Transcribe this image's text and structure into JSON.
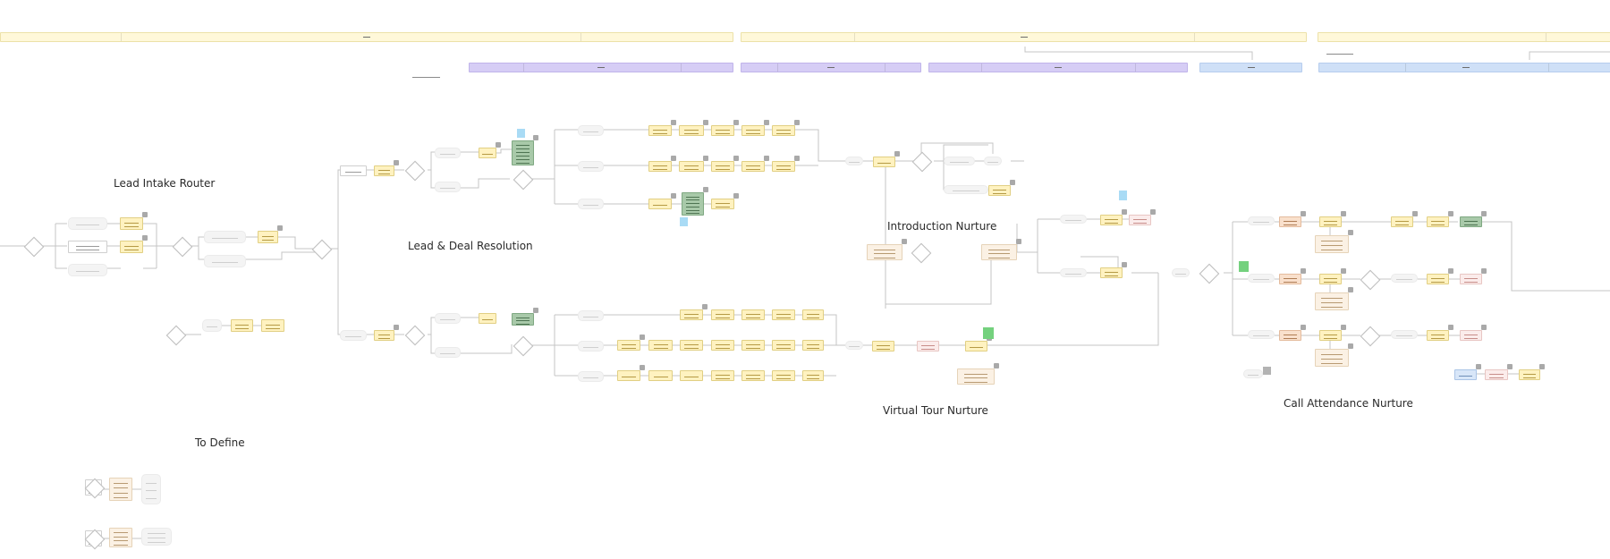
{
  "canvas": {
    "section_titles": {
      "lead_intake_router": "Lead Intake Router",
      "lead_deal_resolution": "Lead & Deal Resolution",
      "introduction_nurture": "Introduction Nurture",
      "virtual_tour_nurture": "Virtual Tour Nurture",
      "call_attendance_nurture": "Call Attendance Nurture",
      "to_define": "To Define"
    },
    "colors": {
      "lane_yellow": "#fff8d9",
      "lane_purple": "#d6cdf5",
      "lane_blue": "#cfe0f7",
      "node_yellow": "#fff2c0",
      "node_green": "#a8c9a9",
      "node_orange": "#f9e0cc",
      "node_pink": "#fbeceb",
      "sticky_blue": "#a9dbf5",
      "sticky_green": "#74d17e",
      "connector": "#c4c4c4"
    },
    "icons": {
      "node_settings": "gear-icon",
      "decision": "diamond-icon",
      "note": "sticky-note-icon"
    }
  }
}
